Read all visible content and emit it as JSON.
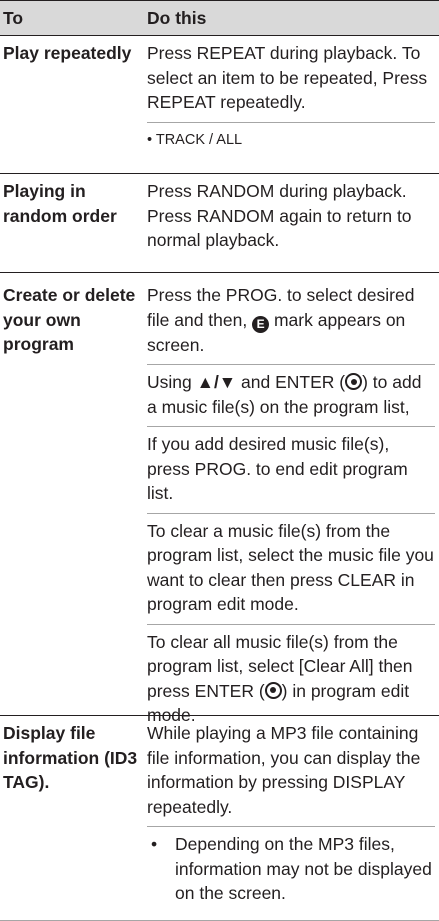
{
  "header": {
    "col1": "To",
    "col2": "Do this"
  },
  "rows": [
    {
      "label": "Play repeatedly",
      "p1": "Press REPEAT during playback. To select an item to be repeated, Press REPEAT repeatedly.",
      "p2": "• TRACK / ALL"
    },
    {
      "label": "Playing in random order",
      "p1": "Press RANDOM during playback. Press RANDOM again to return to normal playback."
    },
    {
      "label": "Create or delete your own program",
      "p1_before": "Press the PROG. to select desired file and then,",
      "p1_symbol": "E",
      "p1_after": "mark appears on screen.",
      "p2_before": "Using",
      "p2_arrows": "▲/▼",
      "p2_mid": "and ENTER (",
      "p2_after": ") to add a music file(s) on the program list,",
      "p3": "If you add desired music file(s), press PROG. to end edit program list.",
      "p4": "To clear a music file(s) from the program list, select the music file you want to clear then press CLEAR in program edit mode.",
      "p5_before": "To clear all music file(s) from the program list, select [Clear All] then press ENTER (",
      "p5_after": ") in program edit mode."
    },
    {
      "label": "Display file information (ID3 TAG).",
      "p1": "While playing a MP3 file containing file information, you can display the information by pressing DISPLAY repeatedly.",
      "bullet": "•",
      "p2": "Depending on the MP3 files, information may not be displayed on the screen."
    }
  ]
}
